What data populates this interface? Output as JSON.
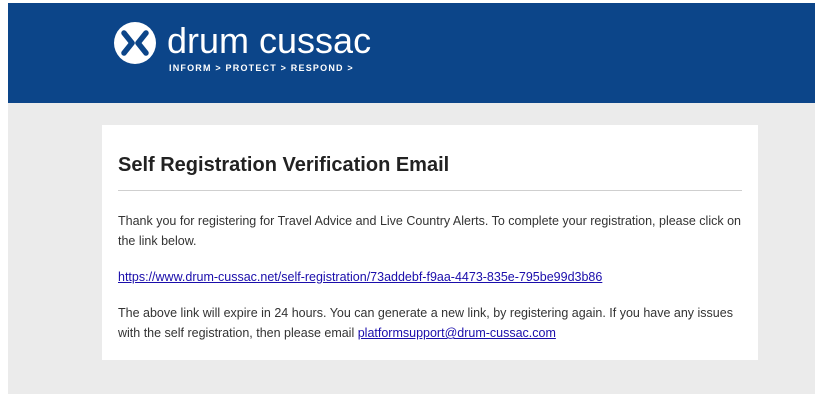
{
  "brand": {
    "name": "drum cussac",
    "tagline": "INFORM > PROTECT > RESPOND >",
    "logo_icon": "drum-cussac-x-logo",
    "banner_color": "#0c4589"
  },
  "email": {
    "title": "Self Registration Verification Email",
    "intro": "Thank you for registering for Travel Advice and Live Country Alerts. To complete your registration, please click on the link below.",
    "verification_link": "https://www.drum-cussac.net/self-registration/73addebf-f9aa-4473-835e-795be99d3b86",
    "expiry_text": "The above link will expire in 24 hours. You can generate a new link, by registering again. If you have any issues with the self registration, then please email ",
    "support_email": "platformsupport@drum-cussac.com"
  }
}
